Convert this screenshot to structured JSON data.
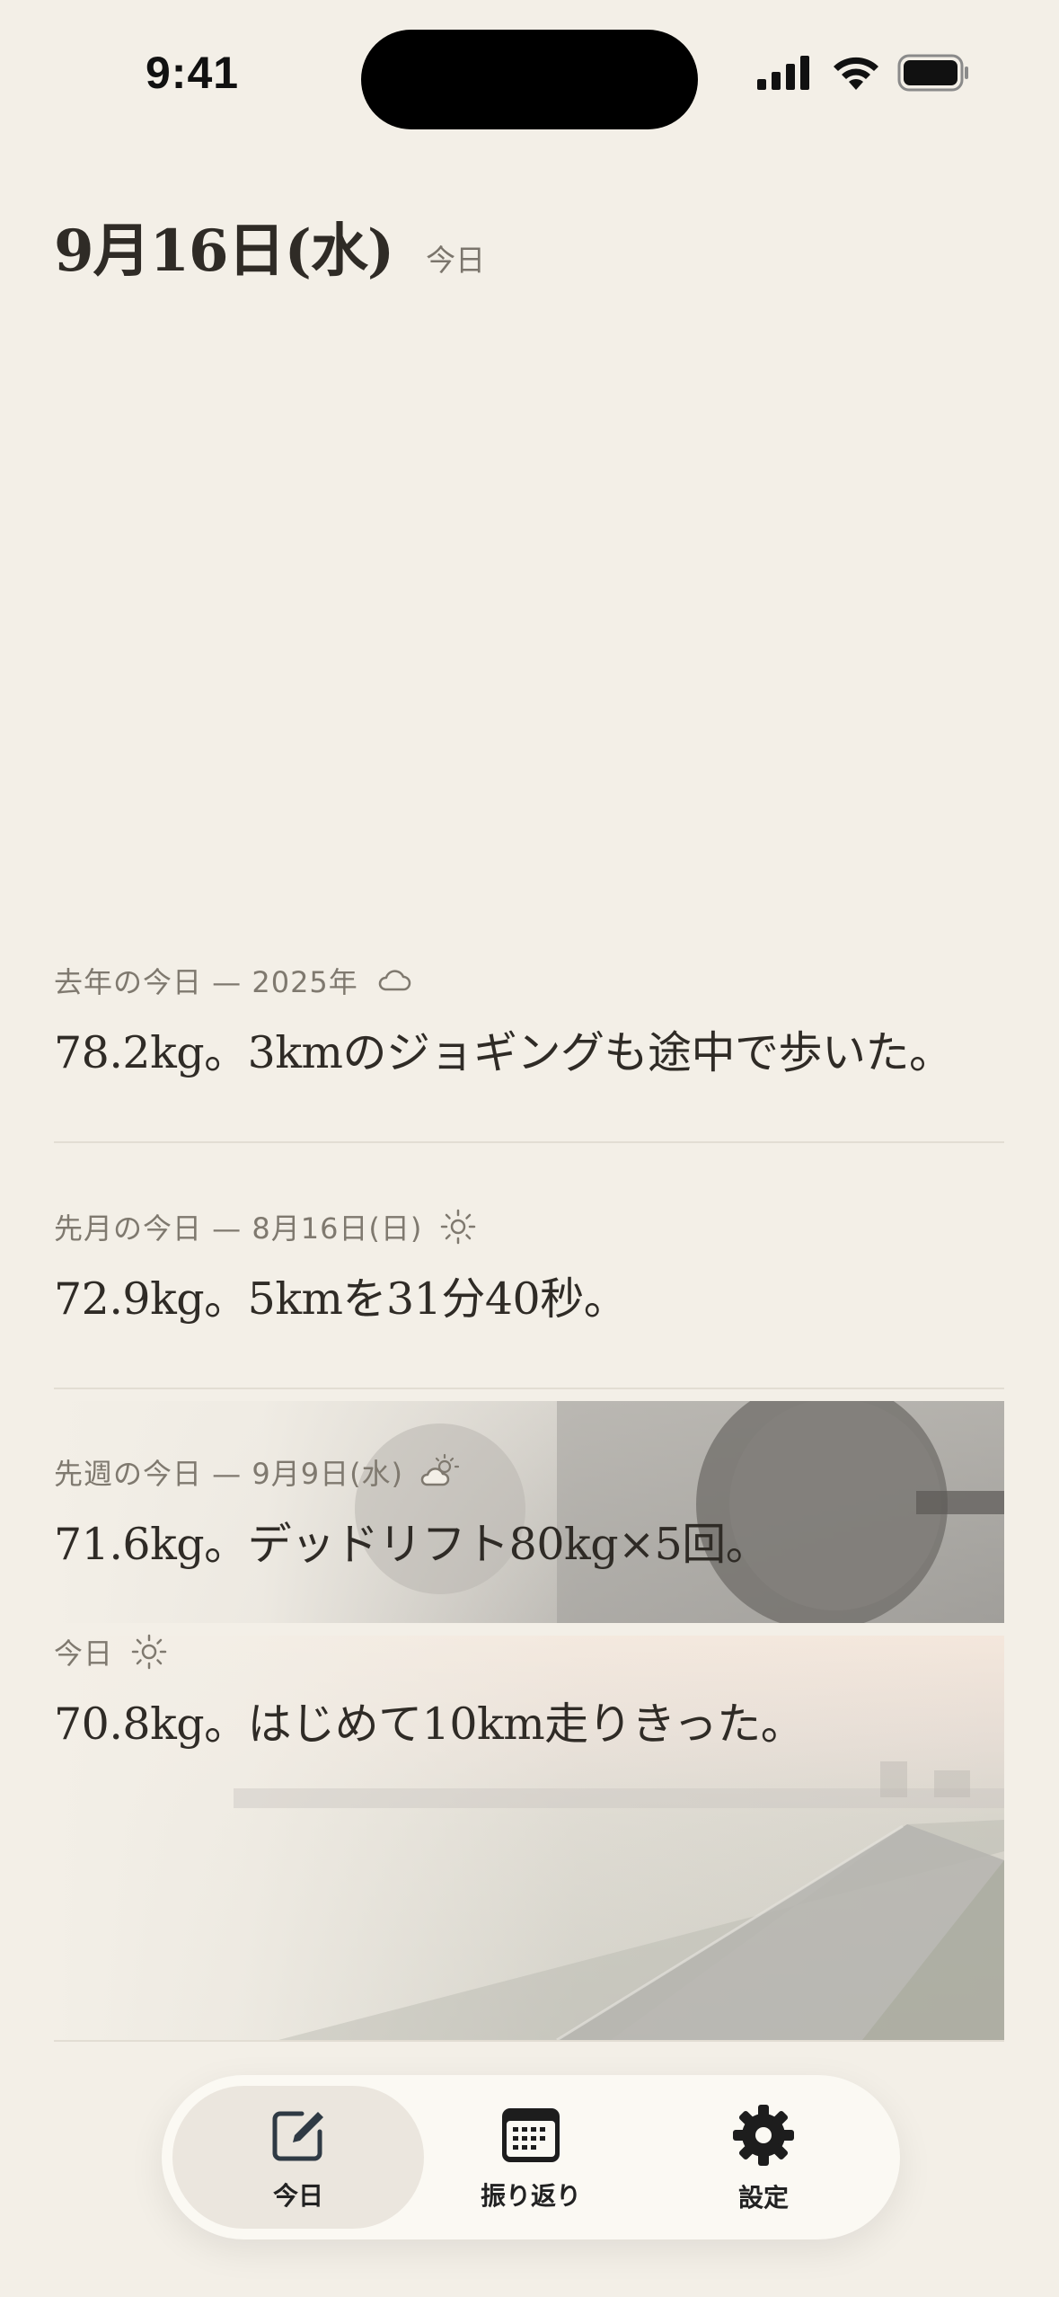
{
  "status_bar": {
    "time": "9:41"
  },
  "header": {
    "date": "9月16日(水)",
    "badge": "今日"
  },
  "entries": [
    {
      "meta": "去年の今日 — 2025年",
      "weather_icon": "cloud-icon",
      "text": "78.2kg。3kmのジョギングも途中で歩いた。"
    },
    {
      "meta": "先月の今日 — 8月16日(日)",
      "weather_icon": "sun-icon",
      "text": "72.9kg。5kmを31分40秒。"
    },
    {
      "meta": "先週の今日 — 9月9日(水)",
      "weather_icon": "partly-cloudy-icon",
      "text": "71.6kg。デッドリフト80kg×5回。"
    },
    {
      "meta": "今日",
      "weather_icon": "sun-icon",
      "text": "70.8kg。はじめて10km走りきった。"
    }
  ],
  "tabbar": {
    "tabs": [
      {
        "label": "今日",
        "icon": "compose-icon",
        "active": true
      },
      {
        "label": "振り返り",
        "icon": "calendar-icon",
        "active": false
      },
      {
        "label": "設定",
        "icon": "gear-icon",
        "active": false
      }
    ]
  }
}
